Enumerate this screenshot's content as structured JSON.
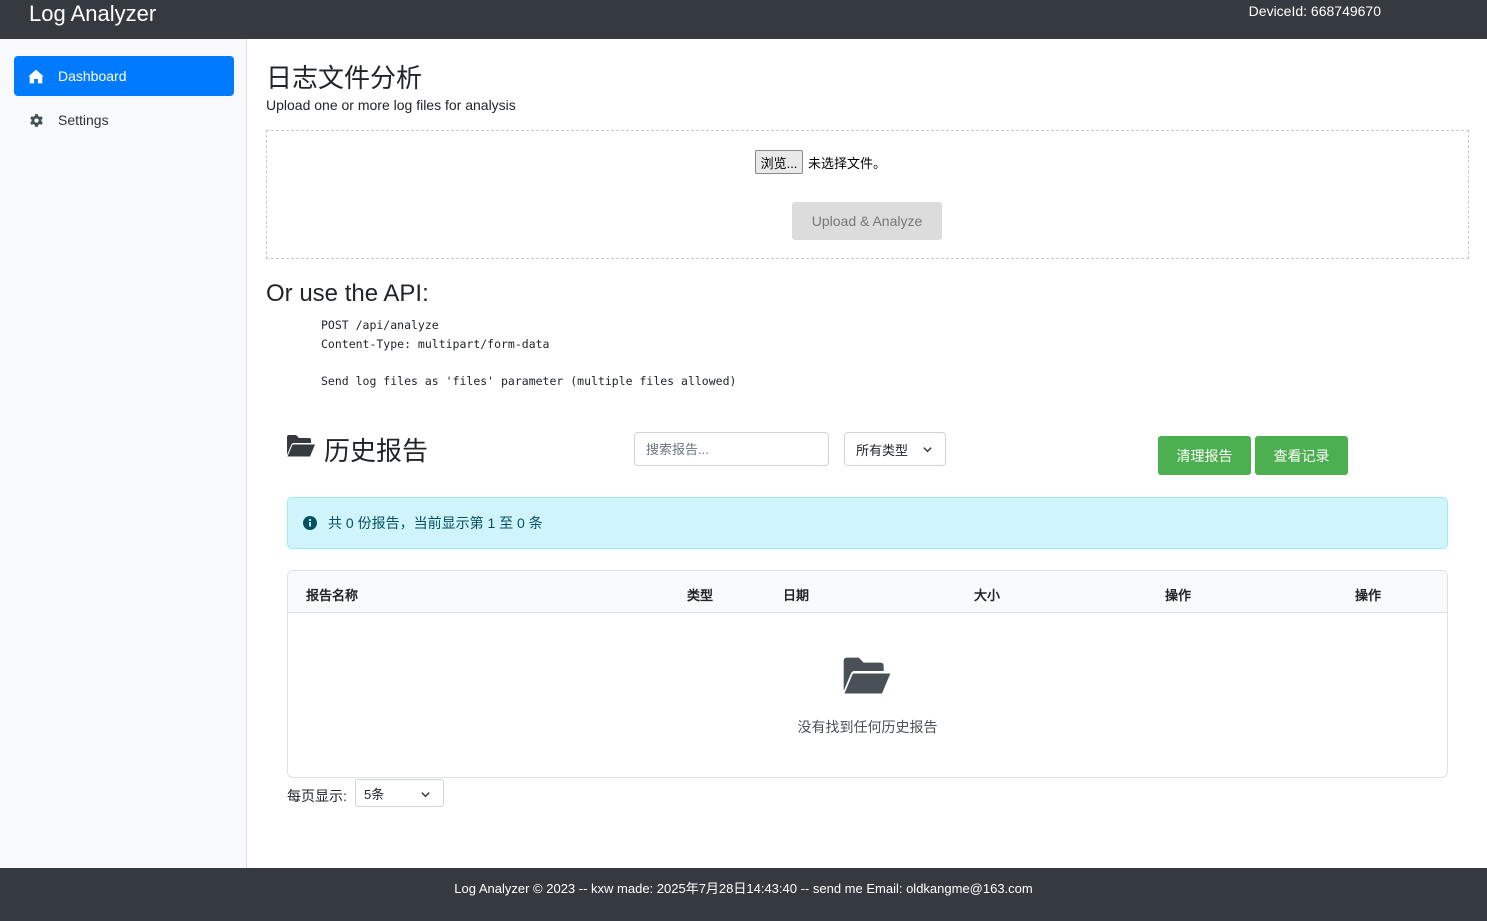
{
  "header": {
    "brand": "Log Analyzer",
    "device_id": "DeviceId: 668749670"
  },
  "sidebar": {
    "items": [
      {
        "label": "Dashboard",
        "icon": "home-icon",
        "active": true
      },
      {
        "label": "Settings",
        "icon": "gear-icon",
        "active": false
      }
    ]
  },
  "upload": {
    "title": "日志文件分析",
    "subtitle": "Upload one or more log files for analysis",
    "browse_label": "浏览...",
    "no_file_text": "未选择文件。",
    "upload_button": "Upload & Analyze"
  },
  "api": {
    "title": "Or use the API:",
    "code": "POST /api/analyze\nContent-Type: multipart/form-data\n\nSend log files as 'files' parameter (multiple files allowed)"
  },
  "history": {
    "title": "历史报告",
    "search_placeholder": "搜索报告...",
    "type_filter": "所有类型",
    "clear_button": "清理报告",
    "view_button": "查看记录",
    "info_text": "共 0 份报告，当前显示第 1 至 0 条",
    "columns": [
      "报告名称",
      "类型",
      "日期",
      "大小",
      "操作",
      "操作"
    ],
    "empty_text": "没有找到任何历史报告",
    "per_page_label": "每页显示:",
    "per_page_value": "5条"
  },
  "footer": {
    "text": "Log Analyzer © 2023 -- kxw made: 2025年7月28日14:43:40 -- send me Email: oldkangme@163.com"
  },
  "colors": {
    "topbar": "#343a40",
    "primary": "#007bff",
    "success": "#4caf50",
    "info_bg": "#cff4fc",
    "info_text": "#055160"
  }
}
